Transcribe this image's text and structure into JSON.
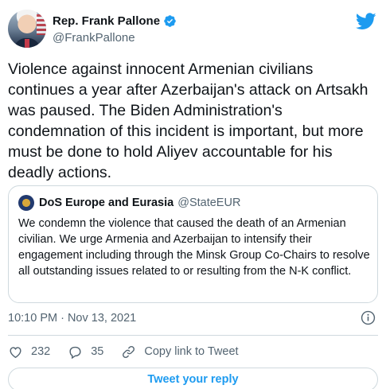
{
  "author": {
    "name": "Rep. Frank Pallone",
    "handle": "@FrankPallone",
    "verified": true
  },
  "tweet_text": "Violence against innocent Armenian civilians continues a year after Azerbaijan's attack on Artsakh was paused. The Biden Administration's condemnation of this incident is important, but more must be done to hold Aliyev accountable for his deadly actions.",
  "quoted": {
    "name": "DoS Europe and Eurasia",
    "handle": "@StateEUR",
    "text": "We condemn the violence that caused the death of an Armenian civilian.  We urge Armenia and Azerbaijan to intensify their engagement including through the Minsk Group Co-Chairs to resolve all outstanding issues related to or resulting from the N-K conflict."
  },
  "timestamp": "10:10 PM · Nov 13, 2021",
  "actions": {
    "likes": "232",
    "replies": "35",
    "copy_link": "Copy link to Tweet"
  },
  "reply_button": "Tweet your reply",
  "colors": {
    "accent": "#1d9bf0",
    "secondary_text": "#536471",
    "border": "#cfd9de"
  },
  "icons": [
    "verified-badge-icon",
    "twitter-bird-icon",
    "info-icon",
    "heart-icon",
    "reply-bubble-icon",
    "link-icon"
  ]
}
